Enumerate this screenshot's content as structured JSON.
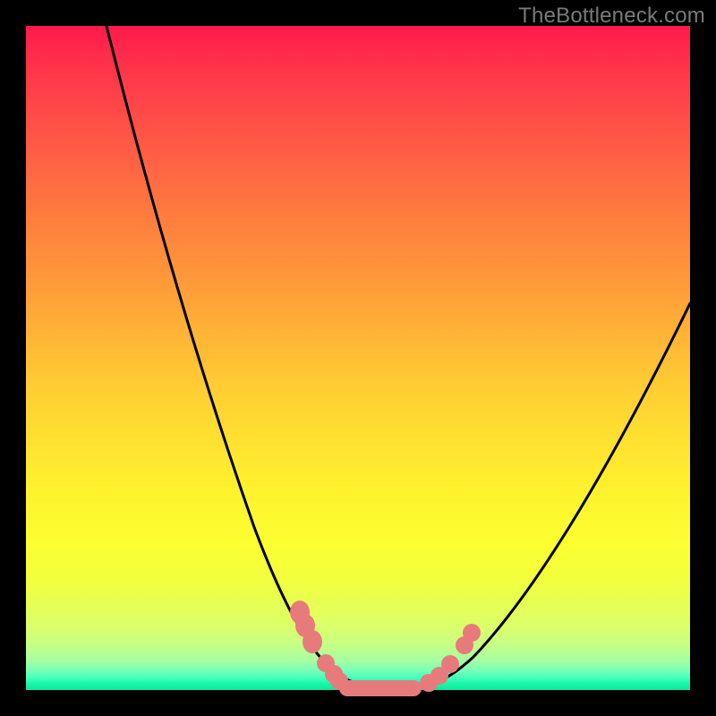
{
  "watermark": "TheBottleneck.com",
  "colors": {
    "frame": "#000000",
    "curve": "#000000",
    "marker": "#e77b7b",
    "gradient_top": "#ff1a4d",
    "gradient_mid": "#ffe030",
    "gradient_bottom": "#12e49a"
  },
  "chart_data": {
    "type": "line",
    "title": "",
    "xlabel": "",
    "ylabel": "",
    "xlim": [
      0,
      100
    ],
    "ylim": [
      0,
      100
    ],
    "grid": false,
    "legend": false,
    "series": [
      {
        "name": "bottleneck-curve",
        "x": [
          0,
          5,
          10,
          15,
          20,
          25,
          30,
          35,
          40,
          45,
          48,
          50,
          52,
          55,
          58,
          62,
          66,
          70,
          75,
          80,
          85,
          90,
          95,
          100
        ],
        "y": [
          100,
          92,
          83,
          74,
          65,
          56,
          47,
          38,
          29,
          18,
          10,
          3,
          0,
          0,
          0,
          2,
          6,
          12,
          19,
          27,
          35,
          43,
          51,
          59
        ]
      }
    ],
    "markers": [
      {
        "x": 40,
        "y": 12
      },
      {
        "x": 41,
        "y": 10
      },
      {
        "x": 42,
        "y": 8
      },
      {
        "x": 44,
        "y": 5
      },
      {
        "x": 46,
        "y": 3
      },
      {
        "x": 48,
        "y": 1
      },
      {
        "x": 50,
        "y": 0
      },
      {
        "x": 53,
        "y": 0
      },
      {
        "x": 56,
        "y": 0
      },
      {
        "x": 58,
        "y": 0.5
      },
      {
        "x": 60,
        "y": 2
      },
      {
        "x": 62,
        "y": 4
      },
      {
        "x": 63,
        "y": 5
      },
      {
        "x": 64,
        "y": 7
      },
      {
        "x": 66,
        "y": 10
      }
    ],
    "flat_segment": {
      "x0": 47,
      "x1": 58,
      "y": 0
    },
    "notes": "V-shaped bottleneck curve over a vertical red→yellow→green gradient; minimum plateaus near zero between roughly x=47 and x=58."
  }
}
